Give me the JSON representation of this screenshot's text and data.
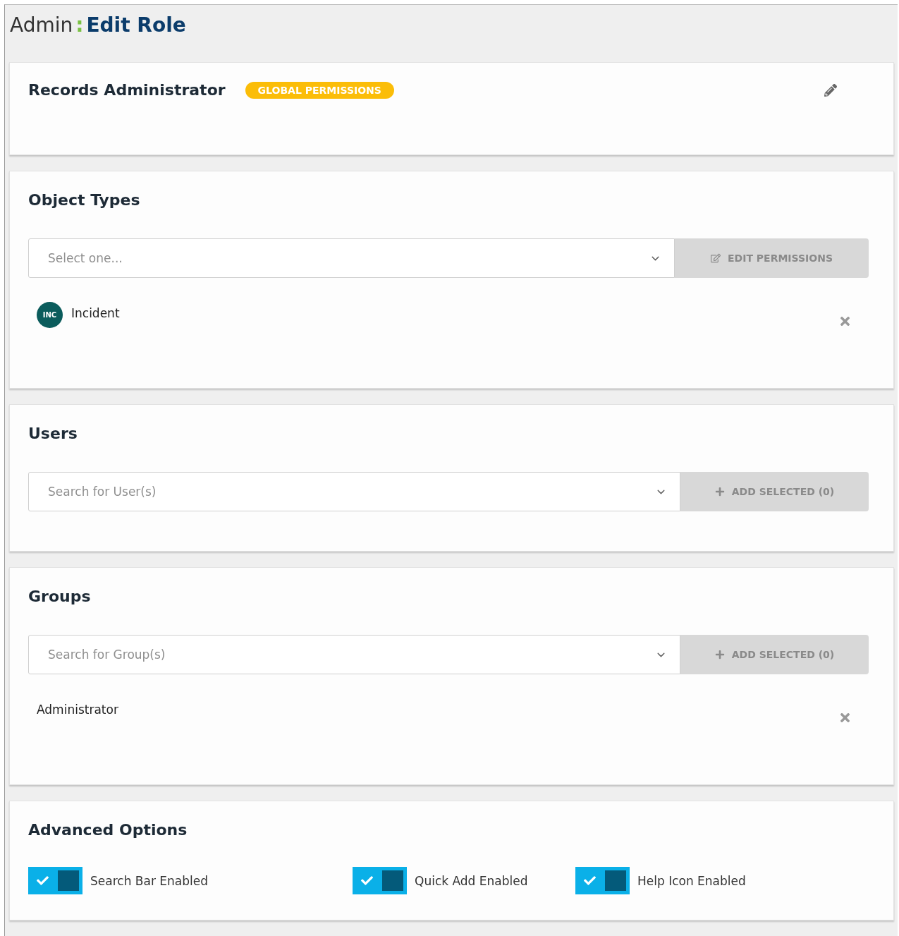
{
  "page_title": {
    "prefix": "Admin",
    "separator": ":",
    "main": "Edit Role"
  },
  "role": {
    "name": "Records Administrator",
    "badge": "GLOBAL PERMISSIONS"
  },
  "sections": [
    {
      "kind": "type_picker",
      "title": "Object Types",
      "placeholder": "Select one...",
      "button": {
        "label": "EDIT PERMISSIONS",
        "disabled": true
      },
      "items": [
        {
          "avatar": "INC",
          "label": "Incident"
        }
      ]
    },
    {
      "kind": "member_picker",
      "title": "Users",
      "placeholder": "Search for User(s)",
      "button": {
        "label": "ADD SELECTED (0)",
        "disabled": true
      }
    },
    {
      "kind": "member_picker",
      "title": "Groups",
      "placeholder": "Search for Group(s)",
      "button": {
        "label": "ADD SELECTED (0)",
        "disabled": true
      },
      "items": [
        {
          "label": "Administrator"
        }
      ]
    },
    {
      "kind": "options",
      "title": "Advanced Options",
      "options": [
        {
          "label": "Search Bar Enabled",
          "checked": true
        },
        {
          "label": "Quick Add Enabled",
          "checked": true
        },
        {
          "label": "Help Icon Enabled",
          "checked": true
        }
      ]
    }
  ]
}
